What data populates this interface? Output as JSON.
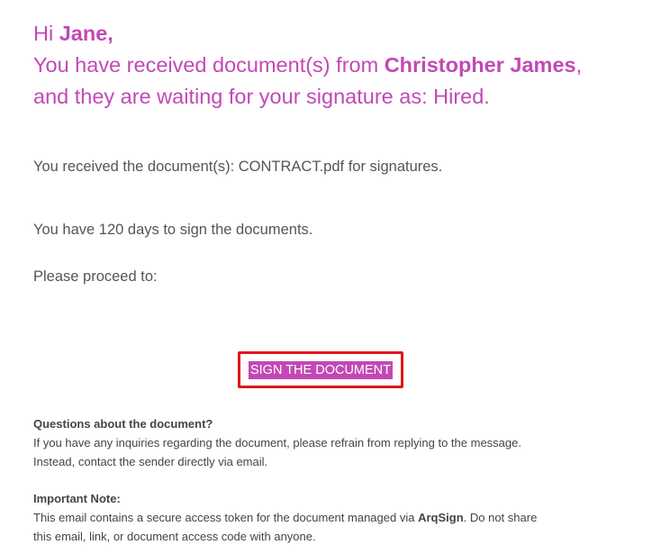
{
  "colors": {
    "accent": "#c348b5",
    "highlight_border": "#e0161b",
    "body_text": "#555555"
  },
  "greeting": {
    "hi": "Hi",
    "recipient_name": "Jane,",
    "line2_prefix": "You have received document(s) from",
    "sender_name": "Christopher James",
    "line2_suffix": ",",
    "line3": "and they are waiting for your signature as: Hired."
  },
  "body": {
    "received": "You received the document(s): CONTRACT.pdf for signatures.",
    "days": "You have 120 days to sign the documents.",
    "proceed": "Please proceed to:"
  },
  "cta": {
    "label": "SIGN THE DOCUMENT"
  },
  "questions": {
    "heading": "Questions about the document?",
    "text_line1": "If you have any inquiries regarding the document, please refrain from replying to the message.",
    "text_line2": "Instead, contact the sender directly via email."
  },
  "note": {
    "heading": "Important Note:",
    "text_before": "This email contains a secure access token for the document managed via",
    "brand": "ArqSign",
    "text_after": ". Do not share",
    "text_line2": "this email, link, or document access code with anyone."
  }
}
